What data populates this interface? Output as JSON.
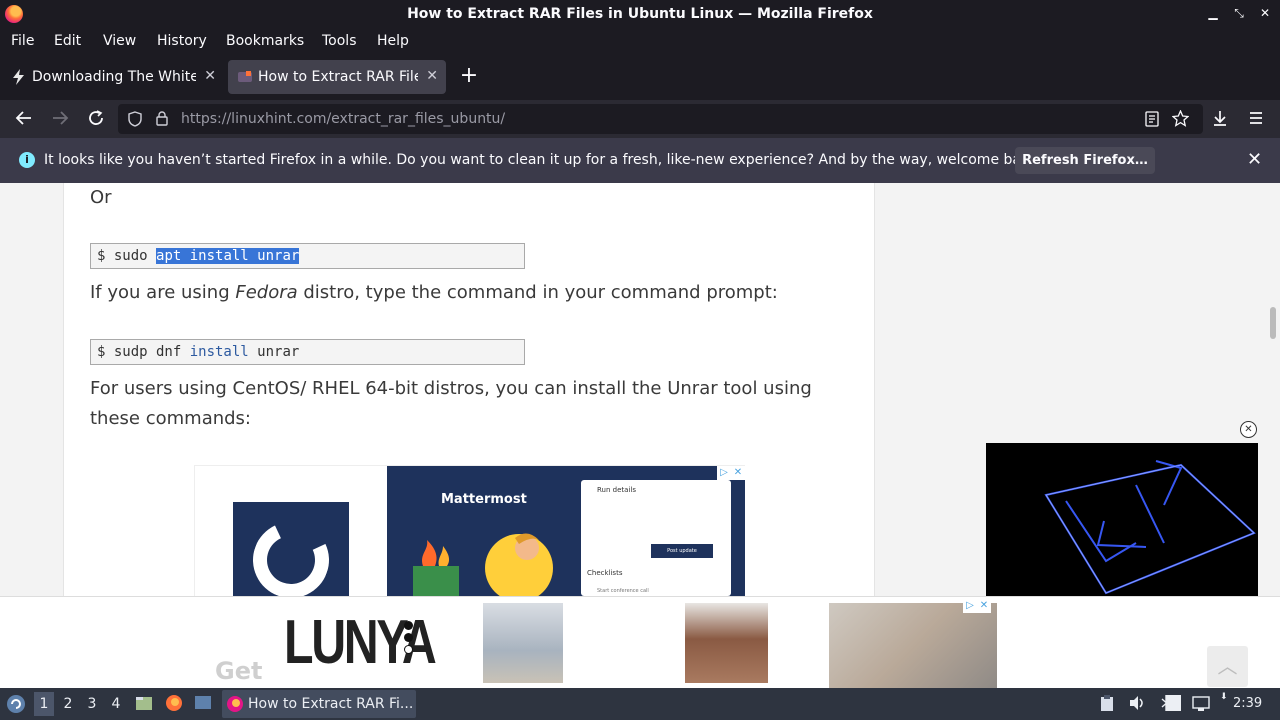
{
  "window": {
    "title": "How to Extract RAR Files in Ubuntu Linux — Mozilla Firefox",
    "buttons": {
      "minimize": "▁",
      "maximize": "⤡",
      "close": "✕"
    }
  },
  "menubar": {
    "items": [
      "File",
      "Edit",
      "View",
      "History",
      "Bookmarks",
      "Tools",
      "Help"
    ]
  },
  "tabs": [
    {
      "label": "Downloading The White H",
      "active": false,
      "icon": "bolt-icon"
    },
    {
      "label": "How to Extract RAR Files",
      "active": true,
      "icon": "linuxhint-favicon"
    }
  ],
  "navbar": {
    "url_host": "https://linuxhint.com",
    "url_path": "/extract_rar_files_ubuntu/"
  },
  "notification": {
    "message": "It looks like you haven’t started Firefox in a while. Do you want to clean it up for a fresh, like-new experience? And by the way, welcome back!",
    "button": "Refresh Firefox…"
  },
  "article": {
    "or_text": "Or",
    "code1_prefix": "$ sudo ",
    "code1_selected": "apt install unrar",
    "para_fedora_before": "If you are using ",
    "para_fedora_em": "Fedora",
    "para_fedora_after": " distro, type the command in your command prompt:",
    "code2_prefix": "$ sudp dnf ",
    "code2_kw": "install",
    "code2_suffix": " unrar",
    "para_centos": "For users using CentOS/ RHEL 64-bit distros, you can install the Unrar tool using these commands:",
    "faded_heading": "Get"
  },
  "ad_mattermost": {
    "brand": "Mattermost",
    "card_title": "Run details",
    "card_button": "Post update",
    "card_checklists": "Checklists",
    "card_checklist_line": "Start conference call"
  },
  "ad_bottom": {
    "brand": "LUNYA"
  },
  "taskbar": {
    "workspaces": [
      "1",
      "2",
      "3",
      "4"
    ],
    "active_task": "How to Extract RAR Fi...",
    "clock": "2:39"
  }
}
